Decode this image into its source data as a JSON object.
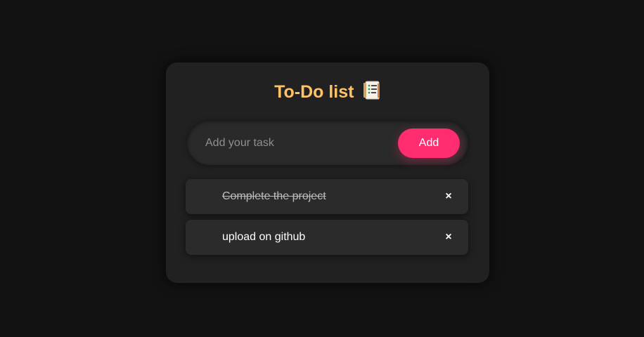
{
  "app": {
    "title": "To-Do list",
    "title_icon": "notebook-icon",
    "colors": {
      "background": "#121212",
      "card": "#212121",
      "title": "#ffc266",
      "accent": "#ff2d6f",
      "task_item": "#2b2b2b"
    }
  },
  "input": {
    "value": "",
    "placeholder": "Add your task"
  },
  "add_button": {
    "label": "Add"
  },
  "tasks": [
    {
      "text": "Complete the project",
      "completed": true,
      "delete_label": "×",
      "delete_icon": "close-icon"
    },
    {
      "text": "upload on github",
      "completed": false,
      "delete_label": "×",
      "delete_icon": "close-icon"
    }
  ]
}
